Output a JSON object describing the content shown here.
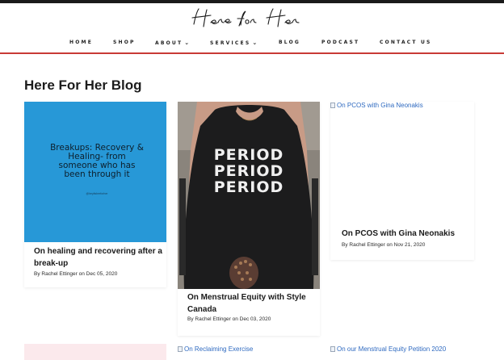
{
  "brand": {
    "logo_text": "Here for Her"
  },
  "nav": {
    "items": [
      {
        "label": "HOME",
        "has_dropdown": false
      },
      {
        "label": "SHOP",
        "has_dropdown": false
      },
      {
        "label": "ABOUT",
        "has_dropdown": true
      },
      {
        "label": "SERVICES",
        "has_dropdown": true
      },
      {
        "label": "BLOG",
        "has_dropdown": false
      },
      {
        "label": "PODCAST",
        "has_dropdown": false
      },
      {
        "label": "CONTACT US",
        "has_dropdown": false
      }
    ],
    "dropdown_icon": "chevron-down-icon"
  },
  "page": {
    "title": "Here For Her Blog"
  },
  "posts": [
    {
      "image_text": "Breakups: Recovery & Healing- from someone who has been through it",
      "image_credit": "@heyitsherforher",
      "title": "On healing and recovering after a break-up",
      "meta": "By Rachel Ettinger on Dec 05, 2020"
    },
    {
      "image_text": "PERIOD PERIOD PERIOD",
      "title": "On Menstrual Equity with Style Canada",
      "meta": "By Rachel Ettinger on Dec 03, 2020"
    },
    {
      "image_alt": "On PCOS with Gina Neonakis",
      "title": "On PCOS with Gina Neonakis",
      "meta": "By Rachel Ettinger on Nov 21, 2020"
    }
  ],
  "next_row": [
    {
      "image_alt": "On Reclaiming Exercise"
    },
    {
      "image_alt": "On our Menstrual Equity Petition 2020"
    }
  ],
  "colors": {
    "accent_rule": "#c83a36",
    "card1_bg": "#2798d7",
    "link": "#2f6ac0"
  }
}
